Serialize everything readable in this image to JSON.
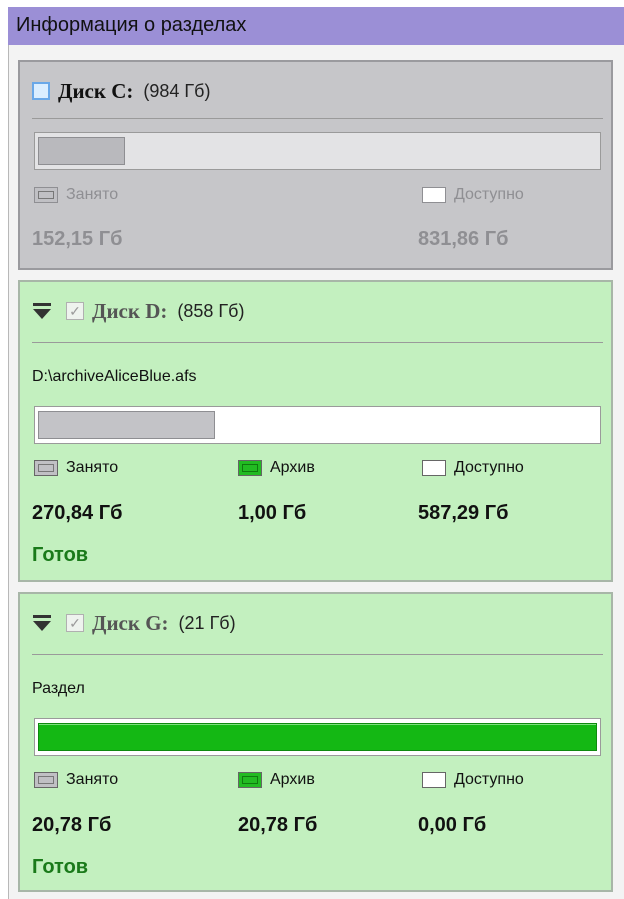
{
  "window": {
    "title": "Информация о разделах"
  },
  "colors": {
    "titlebar": "#9b8fd6",
    "gray_panel": "#c6c6c9",
    "green_panel": "#c3f0bf",
    "used": "#c0c0c4",
    "archive": "#22bb22",
    "status": "#1a7a1a"
  },
  "legend": {
    "used": "Занято",
    "archive": "Архив",
    "available": "Доступно"
  },
  "disks": [
    {
      "name": "Диск C:",
      "size": "(984 Гб)",
      "checked": false,
      "used": "152,15 Гб",
      "available": "831,86 Гб",
      "used_fraction": 0.155
    },
    {
      "name": "Диск D:",
      "size": "(858 Гб)",
      "checked": true,
      "path": "D:\\archiveAliceBlue.afs",
      "used": "270,84 Гб",
      "archive": "1,00 Гб",
      "available": "587,29 Гб",
      "status": "Готов",
      "used_fraction": 0.316
    },
    {
      "name": "Диск G:",
      "size": "(21 Гб)",
      "checked": true,
      "path": "Раздел",
      "used": "20,78 Гб",
      "archive": "20,78 Гб",
      "available": "0,00 Гб",
      "status": "Готов",
      "used_fraction": 1.0
    }
  ]
}
